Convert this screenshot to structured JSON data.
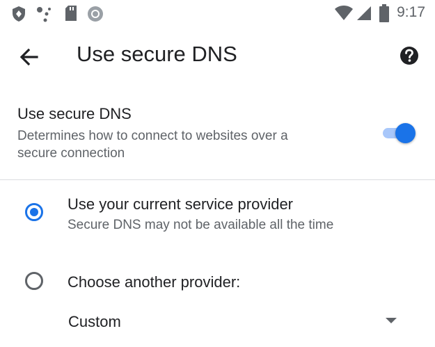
{
  "status_bar": {
    "time": "9:17",
    "left_icons": [
      "shield-icon",
      "assistant-dots-icon",
      "sd-card-icon",
      "circle-status-icon"
    ],
    "right_icons": [
      "wifi-icon",
      "cellular-signal-icon",
      "battery-icon"
    ]
  },
  "toolbar": {
    "title": "Use secure DNS",
    "back_icon": "arrow-back-icon",
    "help_icon": "help-circle-icon"
  },
  "secure_dns": {
    "title": "Use secure DNS",
    "description": "Determines how to connect to websites over a secure connection",
    "enabled": true
  },
  "options": [
    {
      "title": "Use your current service provider",
      "description": "Secure DNS may not be available all the time",
      "selected": true
    },
    {
      "title": "Choose another provider:",
      "selected": false
    }
  ],
  "provider_dropdown": {
    "selected_value": "Custom"
  },
  "colors": {
    "accent": "#1a73e8",
    "track": "#a8c7fa",
    "primary_text": "#202124",
    "secondary_text": "#5f6368",
    "divider": "#dadce0"
  }
}
